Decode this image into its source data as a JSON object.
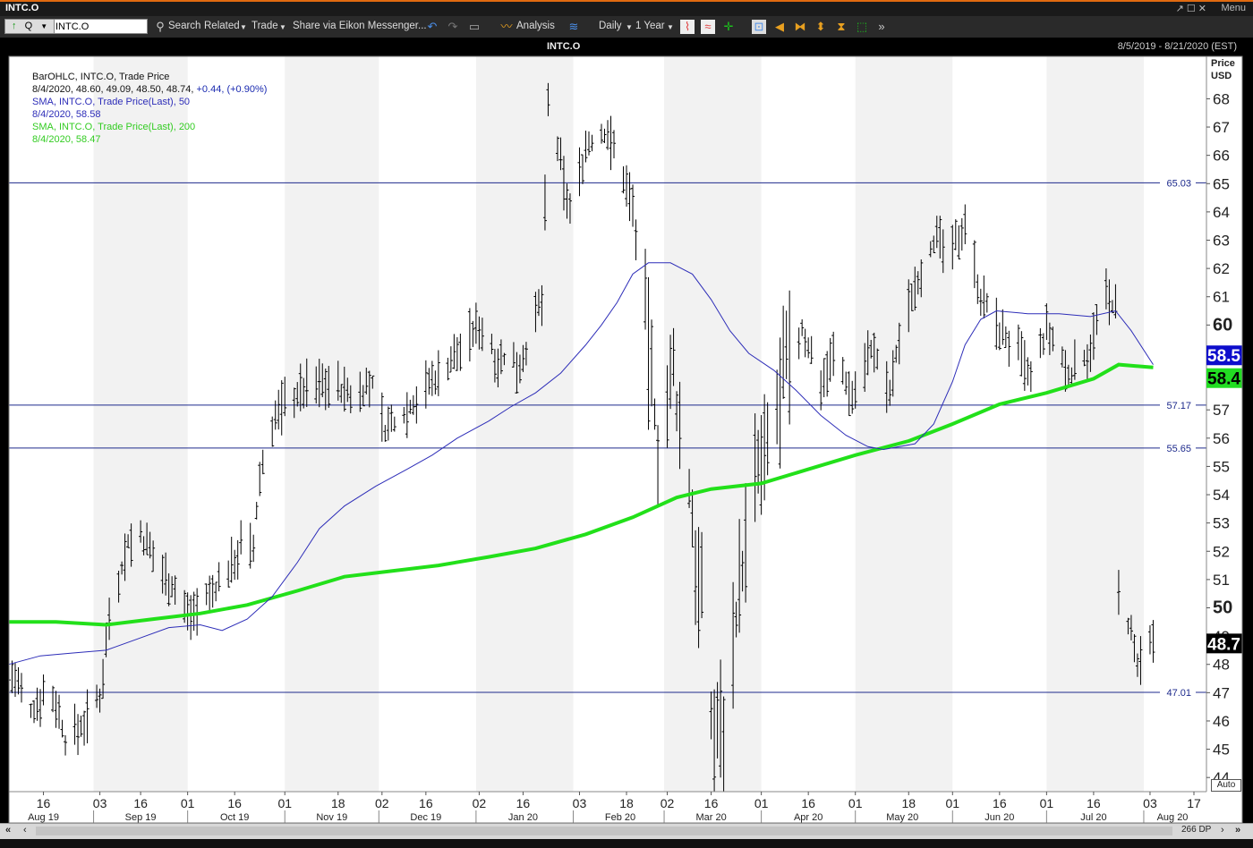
{
  "window": {
    "title": "INTC.O",
    "menu_label": "Menu",
    "controls": "↗ ☐ ✕"
  },
  "toolbar": {
    "up_arrow": "↑",
    "quote_label": "Q",
    "ric_value": "INTC.O",
    "search_label": "Search",
    "related_label": "Related",
    "trade_label": "Trade",
    "share_label": "Share via Eikon Messenger...",
    "analysis_label": "Analysis",
    "interval_label": "Daily",
    "range_label": "1 Year"
  },
  "header": {
    "symbol": "INTC.O",
    "date_range": "8/5/2019 - 8/21/2020 (EST)"
  },
  "bottom": {
    "dp_label": "266 DP"
  },
  "legend": {
    "l1": "BarOHLC, INTC.O, Trade Price",
    "l2a": "8/4/2020, 48.60, 49.09, 48.50, 48.74,",
    "l2b": "+0.44, (+0.90%)",
    "l3": "SMA, INTC.O, Trade Price(Last),  50",
    "l4": "8/4/2020, 58.58",
    "l5": "SMA, INTC.O, Trade Price(Last),  200",
    "l6": "8/4/2020, 58.47"
  },
  "colors": {
    "sma50": "#2d2db8",
    "sma200": "#22e01a",
    "hline": "#1d2a8c",
    "last_price_bg": "#000000",
    "sma50_tag_bg": "#0d0dcc",
    "sma200_tag_bg": "#22dd22",
    "band": "#f2f2f2"
  },
  "chart_data": {
    "type": "ohlc",
    "title": "INTC.O",
    "ylabel": "Price USD",
    "y_axis_title_1": "Price",
    "y_axis_title_2": "USD",
    "auto_label": "Auto",
    "ylim": [
      43.5,
      69.5
    ],
    "yticks": [
      44,
      45,
      46,
      47,
      48,
      49,
      50,
      51,
      52,
      53,
      54,
      55,
      56,
      57,
      58,
      59,
      60,
      61,
      62,
      63,
      64,
      65,
      66,
      67,
      68
    ],
    "bold_ticks": [
      50,
      60
    ],
    "date_range": [
      "2019-08-05",
      "2020-08-21"
    ],
    "x_day_labels": [
      {
        "date": "2019-08-16",
        "label": "16"
      },
      {
        "date": "2019-09-03",
        "label": "03"
      },
      {
        "date": "2019-09-16",
        "label": "16"
      },
      {
        "date": "2019-10-01",
        "label": "01"
      },
      {
        "date": "2019-10-16",
        "label": "16"
      },
      {
        "date": "2019-11-01",
        "label": "01"
      },
      {
        "date": "2019-11-18",
        "label": "18"
      },
      {
        "date": "2019-12-02",
        "label": "02"
      },
      {
        "date": "2019-12-16",
        "label": "16"
      },
      {
        "date": "2020-01-02",
        "label": "02"
      },
      {
        "date": "2020-01-16",
        "label": "16"
      },
      {
        "date": "2020-02-03",
        "label": "03"
      },
      {
        "date": "2020-02-18",
        "label": "18"
      },
      {
        "date": "2020-03-02",
        "label": "02"
      },
      {
        "date": "2020-03-16",
        "label": "16"
      },
      {
        "date": "2020-04-01",
        "label": "01"
      },
      {
        "date": "2020-04-16",
        "label": "16"
      },
      {
        "date": "2020-05-01",
        "label": "01"
      },
      {
        "date": "2020-05-18",
        "label": "18"
      },
      {
        "date": "2020-06-01",
        "label": "01"
      },
      {
        "date": "2020-06-16",
        "label": "16"
      },
      {
        "date": "2020-07-01",
        "label": "01"
      },
      {
        "date": "2020-07-16",
        "label": "16"
      },
      {
        "date": "2020-08-03",
        "label": "03"
      },
      {
        "date": "2020-08-17",
        "label": "17"
      }
    ],
    "x_month_labels": [
      {
        "date": "2019-08-16",
        "label": "Aug 19"
      },
      {
        "date": "2019-09-16",
        "label": "Sep 19"
      },
      {
        "date": "2019-10-16",
        "label": "Oct 19"
      },
      {
        "date": "2019-11-16",
        "label": "Nov 19"
      },
      {
        "date": "2019-12-16",
        "label": "Dec 19"
      },
      {
        "date": "2020-01-16",
        "label": "Jan 20"
      },
      {
        "date": "2020-02-16",
        "label": "Feb 20"
      },
      {
        "date": "2020-03-16",
        "label": "Mar 20"
      },
      {
        "date": "2020-04-16",
        "label": "Apr 20"
      },
      {
        "date": "2020-05-16",
        "label": "May 20"
      },
      {
        "date": "2020-06-16",
        "label": "Jun 20"
      },
      {
        "date": "2020-07-16",
        "label": "Jul 20"
      },
      {
        "date": "2020-08-16",
        "label": "Aug 20"
      }
    ],
    "horizontal_lines": [
      65.03,
      57.17,
      55.65,
      47.01
    ],
    "horizontal_line_labels": [
      "65.03",
      "57.17",
      "55.65",
      "47.01"
    ],
    "last_values": {
      "close": "48.7",
      "sma50": "58.5",
      "sma200": "58.4"
    },
    "series": [
      {
        "name": "SMA 50",
        "points": [
          [
            "2019-08-05",
            48.0
          ],
          [
            "2019-08-15",
            48.3
          ],
          [
            "2019-08-25",
            48.4
          ],
          [
            "2019-09-05",
            48.5
          ],
          [
            "2019-09-15",
            48.9
          ],
          [
            "2019-09-25",
            49.3
          ],
          [
            "2019-10-05",
            49.4
          ],
          [
            "2019-10-12",
            49.2
          ],
          [
            "2019-10-20",
            49.6
          ],
          [
            "2019-10-28",
            50.4
          ],
          [
            "2019-11-05",
            51.6
          ],
          [
            "2019-11-12",
            52.8
          ],
          [
            "2019-11-20",
            53.6
          ],
          [
            "2019-11-30",
            54.3
          ],
          [
            "2019-12-10",
            54.9
          ],
          [
            "2019-12-18",
            55.4
          ],
          [
            "2019-12-26",
            56.0
          ],
          [
            "2020-01-05",
            56.6
          ],
          [
            "2020-01-12",
            57.1
          ],
          [
            "2020-01-20",
            57.6
          ],
          [
            "2020-01-28",
            58.3
          ],
          [
            "2020-02-05",
            59.3
          ],
          [
            "2020-02-10",
            60.0
          ],
          [
            "2020-02-15",
            60.8
          ],
          [
            "2020-02-20",
            61.8
          ],
          [
            "2020-02-25",
            62.2
          ],
          [
            "2020-03-03",
            62.2
          ],
          [
            "2020-03-10",
            61.8
          ],
          [
            "2020-03-16",
            60.9
          ],
          [
            "2020-03-22",
            59.8
          ],
          [
            "2020-03-28",
            59.0
          ],
          [
            "2020-04-05",
            58.4
          ],
          [
            "2020-04-12",
            57.7
          ],
          [
            "2020-04-20",
            56.8
          ],
          [
            "2020-04-28",
            56.1
          ],
          [
            "2020-05-05",
            55.7
          ],
          [
            "2020-05-10",
            55.6
          ],
          [
            "2020-05-20",
            55.8
          ],
          [
            "2020-05-26",
            56.5
          ],
          [
            "2020-06-01",
            58.0
          ],
          [
            "2020-06-05",
            59.3
          ],
          [
            "2020-06-10",
            60.2
          ],
          [
            "2020-06-15",
            60.5
          ],
          [
            "2020-06-25",
            60.4
          ],
          [
            "2020-07-05",
            60.4
          ],
          [
            "2020-07-15",
            60.3
          ],
          [
            "2020-07-23",
            60.5
          ],
          [
            "2020-07-28",
            59.8
          ],
          [
            "2020-08-04",
            58.6
          ]
        ]
      },
      {
        "name": "SMA 200",
        "points": [
          [
            "2019-08-05",
            49.5
          ],
          [
            "2019-08-20",
            49.5
          ],
          [
            "2019-09-05",
            49.4
          ],
          [
            "2019-09-20",
            49.6
          ],
          [
            "2019-10-05",
            49.8
          ],
          [
            "2019-10-20",
            50.1
          ],
          [
            "2019-11-05",
            50.6
          ],
          [
            "2019-11-20",
            51.1
          ],
          [
            "2019-12-05",
            51.3
          ],
          [
            "2019-12-20",
            51.5
          ],
          [
            "2020-01-05",
            51.8
          ],
          [
            "2020-01-20",
            52.1
          ],
          [
            "2020-02-05",
            52.6
          ],
          [
            "2020-02-20",
            53.2
          ],
          [
            "2020-03-05",
            53.9
          ],
          [
            "2020-03-16",
            54.2
          ],
          [
            "2020-04-01",
            54.4
          ],
          [
            "2020-04-16",
            54.9
          ],
          [
            "2020-05-01",
            55.4
          ],
          [
            "2020-05-18",
            55.9
          ],
          [
            "2020-06-01",
            56.5
          ],
          [
            "2020-06-16",
            57.2
          ],
          [
            "2020-07-01",
            57.6
          ],
          [
            "2020-07-16",
            58.1
          ],
          [
            "2020-07-24",
            58.6
          ],
          [
            "2020-08-04",
            58.5
          ]
        ]
      }
    ],
    "ohlc_key_points": [
      [
        "2019-08-05",
        47.8
      ],
      [
        "2019-08-12",
        46.3
      ],
      [
        "2019-08-16",
        47.0
      ],
      [
        "2019-08-20",
        46.7
      ],
      [
        "2019-08-23",
        45.3
      ],
      [
        "2019-08-28",
        45.8
      ],
      [
        "2019-09-03",
        46.8
      ],
      [
        "2019-09-06",
        49.8
      ],
      [
        "2019-09-12",
        52.3
      ],
      [
        "2019-09-16",
        52.5
      ],
      [
        "2019-09-20",
        51.8
      ],
      [
        "2019-09-25",
        51.0
      ],
      [
        "2019-10-01",
        49.8
      ],
      [
        "2019-10-08",
        50.4
      ],
      [
        "2019-10-15",
        51.5
      ],
      [
        "2019-10-18",
        52.2
      ],
      [
        "2019-10-22",
        52.0
      ],
      [
        "2019-10-24",
        54.6
      ],
      [
        "2019-10-28",
        56.5
      ],
      [
        "2019-11-01",
        57.3
      ],
      [
        "2019-11-08",
        57.8
      ],
      [
        "2019-11-15",
        58.0
      ],
      [
        "2019-11-22",
        57.5
      ],
      [
        "2019-11-29",
        57.9
      ],
      [
        "2019-12-03",
        56.3
      ],
      [
        "2019-12-10",
        57.0
      ],
      [
        "2019-12-16",
        57.8
      ],
      [
        "2019-12-23",
        58.6
      ],
      [
        "2020-01-02",
        60.0
      ],
      [
        "2020-01-08",
        58.8
      ],
      [
        "2020-01-15",
        58.6
      ],
      [
        "2020-01-22",
        60.8
      ],
      [
        "2020-01-24",
        67.8
      ],
      [
        "2020-01-31",
        64.0
      ],
      [
        "2020-02-05",
        66.3
      ],
      [
        "2020-02-12",
        66.8
      ],
      [
        "2020-02-20",
        64.3
      ],
      [
        "2020-02-24",
        60.0
      ],
      [
        "2020-02-28",
        56.0
      ],
      [
        "2020-03-04",
        58.0
      ],
      [
        "2020-03-09",
        54.0
      ],
      [
        "2020-03-13",
        50.0
      ],
      [
        "2020-03-16",
        45.8
      ],
      [
        "2020-03-20",
        46.0
      ],
      [
        "2020-03-24",
        50.0
      ],
      [
        "2020-03-30",
        54.5
      ],
      [
        "2020-04-02",
        55.0
      ],
      [
        "2020-04-08",
        58.0
      ],
      [
        "2020-04-14",
        59.8
      ],
      [
        "2020-04-20",
        58.0
      ],
      [
        "2020-04-24",
        59.0
      ],
      [
        "2020-04-30",
        57.5
      ],
      [
        "2020-05-06",
        59.2
      ],
      [
        "2020-05-12",
        57.5
      ],
      [
        "2020-05-15",
        59.5
      ],
      [
        "2020-05-20",
        61.5
      ],
      [
        "2020-05-26",
        63.0
      ],
      [
        "2020-06-01",
        62.5
      ],
      [
        "2020-06-05",
        63.8
      ],
      [
        "2020-06-10",
        61.0
      ],
      [
        "2020-06-16",
        59.8
      ],
      [
        "2020-06-22",
        59.0
      ],
      [
        "2020-06-26",
        58.0
      ],
      [
        "2020-07-01",
        59.8
      ],
      [
        "2020-07-08",
        58.2
      ],
      [
        "2020-07-14",
        59.0
      ],
      [
        "2020-07-20",
        61.0
      ],
      [
        "2020-07-23",
        60.5
      ],
      [
        "2020-07-24",
        50.5
      ],
      [
        "2020-07-28",
        49.0
      ],
      [
        "2020-07-30",
        47.8
      ],
      [
        "2020-08-04",
        48.7
      ]
    ]
  }
}
